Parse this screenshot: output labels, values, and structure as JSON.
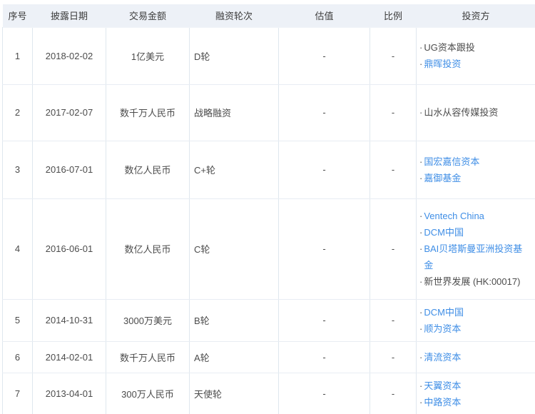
{
  "colors": {
    "link": "#3f8ee6",
    "header_bg": "#edf1f7",
    "vertical_border": "#dfe7ee",
    "horizontal_border": "#e8edf3",
    "text": "#4c4c4c"
  },
  "bullet": "·",
  "table": {
    "columns": [
      {
        "key": "index",
        "label": "序号"
      },
      {
        "key": "date",
        "label": "披露日期"
      },
      {
        "key": "amount",
        "label": "交易金额"
      },
      {
        "key": "round",
        "label": "融资轮次"
      },
      {
        "key": "valuation",
        "label": "估值"
      },
      {
        "key": "ratio",
        "label": "比例"
      },
      {
        "key": "investors",
        "label": "投资方"
      }
    ],
    "rows": [
      {
        "index": "1",
        "date": "2018-02-02",
        "amount": "1亿美元",
        "round": "D轮",
        "valuation": "-",
        "ratio": "-",
        "investors": [
          {
            "name": "UG资本跟投",
            "link": false
          },
          {
            "name": "鼎晖投资",
            "link": true
          }
        ]
      },
      {
        "index": "2",
        "date": "2017-02-07",
        "amount": "数千万人民币",
        "round": "战略融资",
        "valuation": "-",
        "ratio": "-",
        "investors": [
          {
            "name": "山水从容传媒投资",
            "link": false
          }
        ]
      },
      {
        "index": "3",
        "date": "2016-07-01",
        "amount": "数亿人民币",
        "round": "C+轮",
        "valuation": "-",
        "ratio": "-",
        "investors": [
          {
            "name": "国宏嘉信资本",
            "link": true
          },
          {
            "name": "嘉御基金",
            "link": true
          }
        ]
      },
      {
        "index": "4",
        "date": "2016-06-01",
        "amount": "数亿人民币",
        "round": "C轮",
        "valuation": "-",
        "ratio": "-",
        "investors": [
          {
            "name": "Ventech China",
            "link": true
          },
          {
            "name": "DCM中国",
            "link": true
          },
          {
            "name": "BAI贝塔斯曼亚洲投资基金",
            "link": true
          },
          {
            "name": "新世界发展 (HK:00017)",
            "link": false
          }
        ]
      },
      {
        "index": "5",
        "date": "2014-10-31",
        "amount": "3000万美元",
        "round": "B轮",
        "valuation": "-",
        "ratio": "-",
        "investors": [
          {
            "name": "DCM中国",
            "link": true
          },
          {
            "name": "顺为资本",
            "link": true
          }
        ]
      },
      {
        "index": "6",
        "date": "2014-02-01",
        "amount": "数千万人民币",
        "round": "A轮",
        "valuation": "-",
        "ratio": "-",
        "investors": [
          {
            "name": "清流资本",
            "link": true
          }
        ]
      },
      {
        "index": "7",
        "date": "2013-04-01",
        "amount": "300万人民币",
        "round": "天使轮",
        "valuation": "-",
        "ratio": "-",
        "investors": [
          {
            "name": "天翼资本",
            "link": true
          },
          {
            "name": "中路资本",
            "link": true
          }
        ]
      }
    ]
  }
}
